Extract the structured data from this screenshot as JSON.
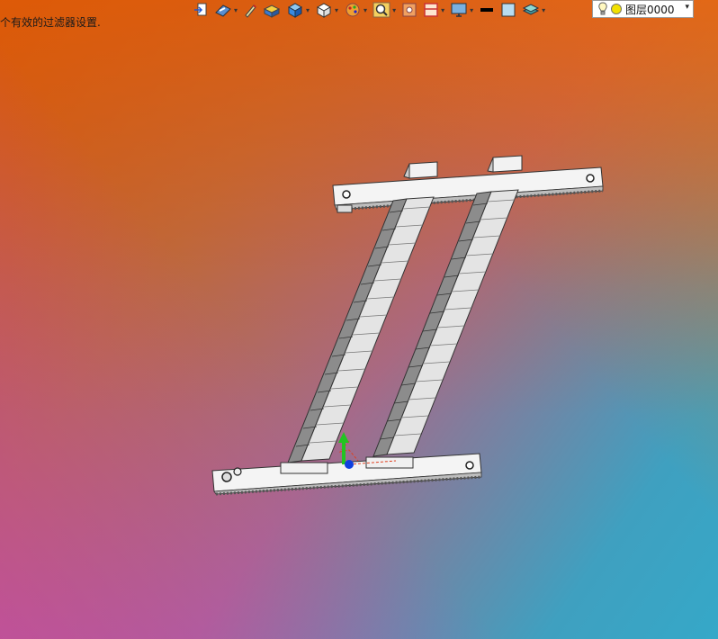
{
  "status_text": "个有效的过滤器设置.",
  "toolbar": {
    "items": [
      {
        "icon": "exit-sketch-icon"
      },
      {
        "icon": "view-orientation-icon",
        "has_dropdown": true
      },
      {
        "icon": "edit-pen-icon"
      },
      {
        "icon": "section-view-icon"
      },
      {
        "icon": "display-style-icon",
        "has_dropdown": true
      },
      {
        "icon": "view-cube-icon",
        "has_dropdown": true
      },
      {
        "icon": "appearance-icon",
        "has_dropdown": true
      },
      {
        "icon": "zoom-icon",
        "has_dropdown": true
      },
      {
        "icon": "camera-icon"
      },
      {
        "icon": "split-view-icon",
        "has_dropdown": true
      },
      {
        "icon": "monitor-icon",
        "has_dropdown": true
      },
      {
        "icon": "line-color-icon"
      },
      {
        "icon": "fill-color-icon"
      },
      {
        "icon": "layer-stack-icon",
        "has_dropdown": true
      }
    ]
  },
  "layer_selector": {
    "label": "图层0000",
    "colors": {
      "bulb": "#ffd700",
      "sun": "#f2e100"
    }
  },
  "model": {
    "colors": {
      "frame": "#f4f4f4",
      "outline": "#333333",
      "chain_light": "#e6e6e6",
      "chain_dark": "#9a9a9a",
      "axis_y": "#22c422",
      "axis_z": "#1040e0",
      "axis_x": "#e04020"
    }
  },
  "viewport_colors": {
    "top": "#e8600c",
    "bottom_left": "#35a8c8",
    "bottom_right": "#c440d0"
  }
}
